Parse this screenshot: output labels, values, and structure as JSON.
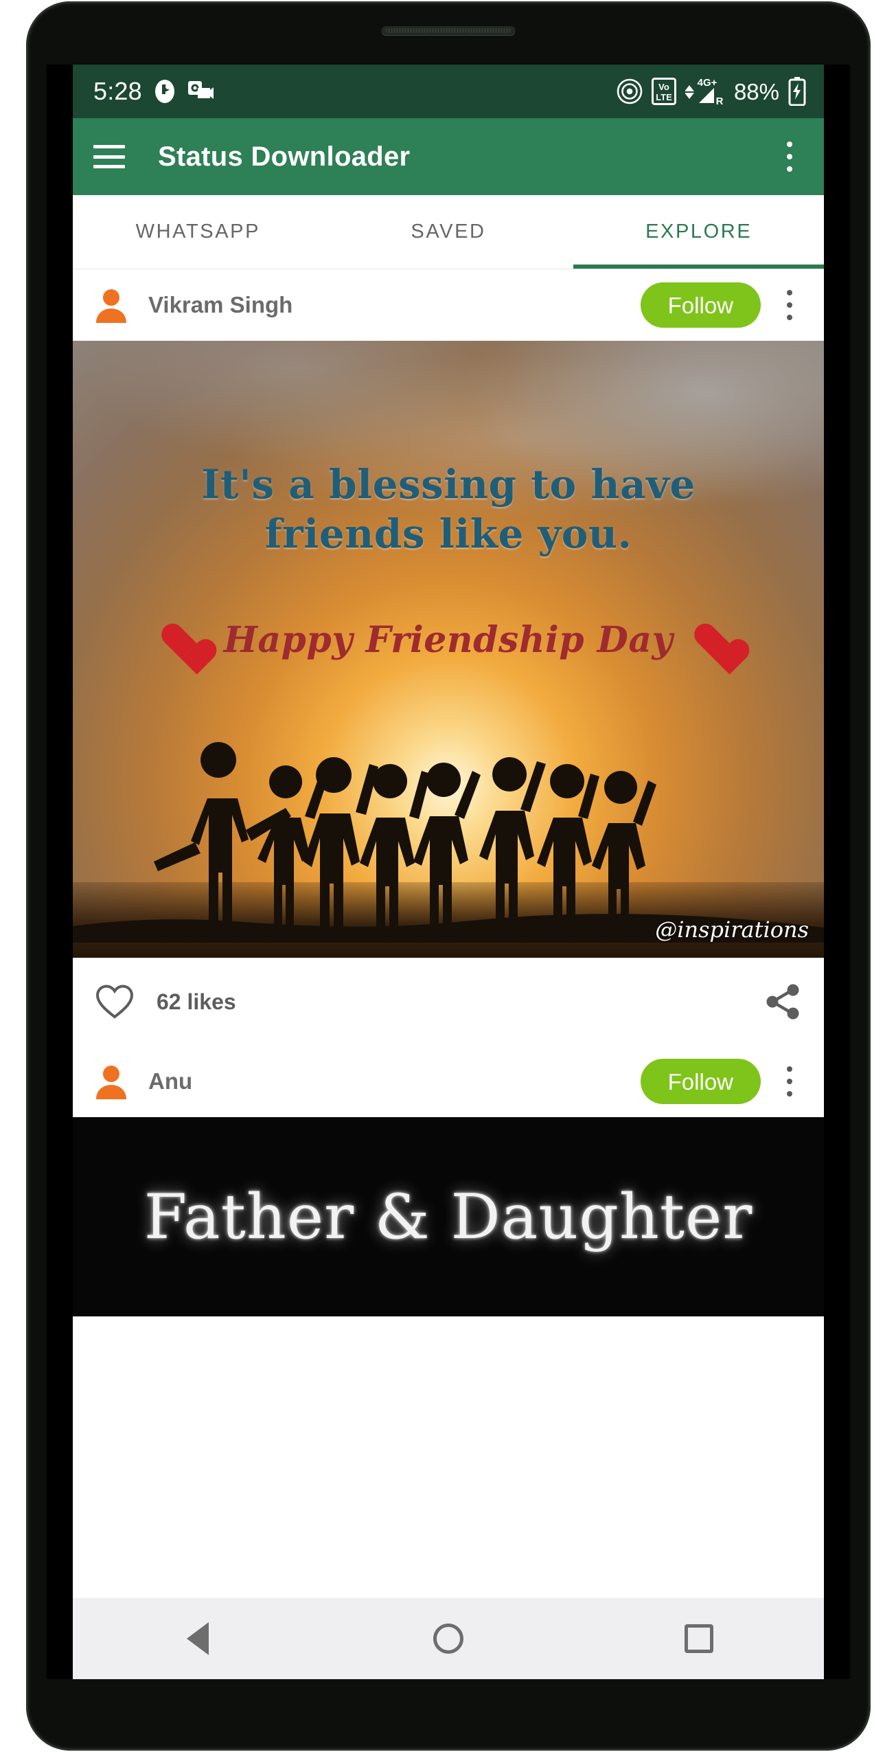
{
  "status_bar": {
    "time": "5:28",
    "battery_percent": "88%",
    "network_label": "4G+",
    "volte_label_top": "Vo",
    "volte_label_bottom": "LTE",
    "roaming_label": "R",
    "icons": [
      "truecaller-notification-icon",
      "outlook-notification-icon",
      "hotspot-icon",
      "volte-icon",
      "signal-4g-plus-icon",
      "battery-charging-icon"
    ],
    "background_color": "#1c4733"
  },
  "app_bar": {
    "title": "Status Downloader",
    "menu_icon": "hamburger-menu-icon",
    "overflow_icon": "overflow-menu-icon",
    "background_color": "#2e8056"
  },
  "tabs": {
    "items": [
      {
        "label": "WHATSAPP",
        "active": false
      },
      {
        "label": "SAVED",
        "active": false
      },
      {
        "label": "EXPLORE",
        "active": true
      }
    ],
    "active_color": "#2b7a4f",
    "inactive_color": "#666666"
  },
  "feed": {
    "posts": [
      {
        "username": "Vikram Singh",
        "follow_label": "Follow",
        "likes_label": "62 likes",
        "likes_count": 62,
        "media": {
          "kind": "friendship-day-poster",
          "line1": "It's a blessing to have",
          "line2": "friends like you.",
          "headline": "Happy Friendship Day",
          "watermark": "@inspirations"
        }
      },
      {
        "username": "Anu",
        "follow_label": "Follow",
        "media": {
          "kind": "father-daughter-poster",
          "title": "Father & Daughter"
        }
      }
    ],
    "follow_button_color": "#7fc41a",
    "avatar_color": "#ef7223"
  },
  "nav_bar": {
    "back": "back-triangle-icon",
    "home": "home-circle-icon",
    "recents": "recents-square-icon"
  }
}
